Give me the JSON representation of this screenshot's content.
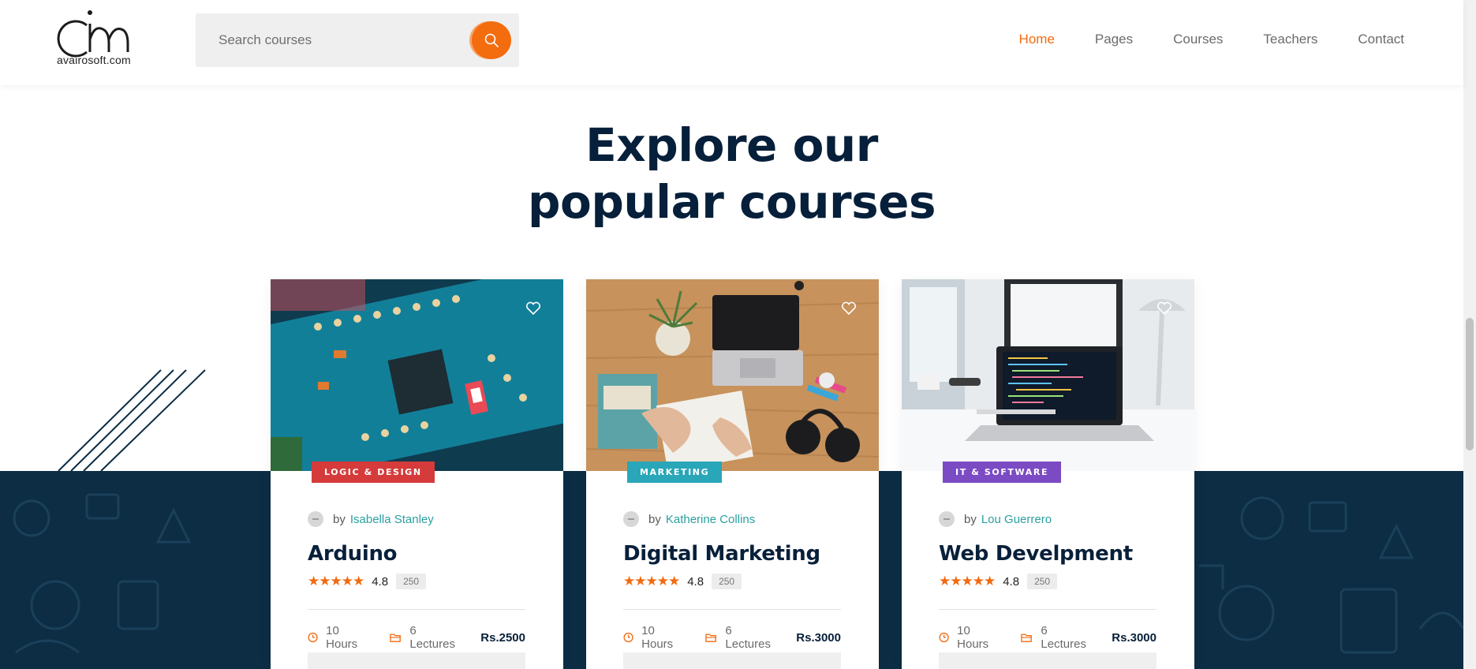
{
  "header": {
    "logo_text": "avairosoft.com",
    "search_placeholder": "Search courses",
    "nav": [
      {
        "label": "Home",
        "active": true
      },
      {
        "label": "Pages",
        "active": false
      },
      {
        "label": "Courses",
        "active": false
      },
      {
        "label": "Teachers",
        "active": false
      },
      {
        "label": "Contact",
        "active": false
      }
    ]
  },
  "section": {
    "title_line1": "Explore our",
    "title_line2": "popular courses"
  },
  "colors": {
    "accent": "#f26a0f",
    "navy": "#0d2d44",
    "teal": "#2ba0a0"
  },
  "courses": [
    {
      "category": "LOGIC & DESIGN",
      "category_color": "#d53b3b",
      "by": "by",
      "author": "Isabella Stanley",
      "title": "Arduino",
      "rating": "4.8",
      "reviews": "250",
      "hours": "10 Hours",
      "lectures": "6 Lectures",
      "price": "Rs.2500"
    },
    {
      "category": "MARKETING",
      "category_color": "#2aa6b9",
      "by": "by",
      "author": "Katherine Collins",
      "title": "Digital Marketing",
      "rating": "4.8",
      "reviews": "250",
      "hours": "10 Hours",
      "lectures": "6 Lectures",
      "price": "Rs.3000"
    },
    {
      "category": "IT & SOFTWARE",
      "category_color": "#7b4bc4",
      "by": "by",
      "author": "Lou Guerrero",
      "title": "Web Develpment",
      "rating": "4.8",
      "reviews": "250",
      "hours": "10 Hours",
      "lectures": "6 Lectures",
      "price": "Rs.3000"
    }
  ]
}
